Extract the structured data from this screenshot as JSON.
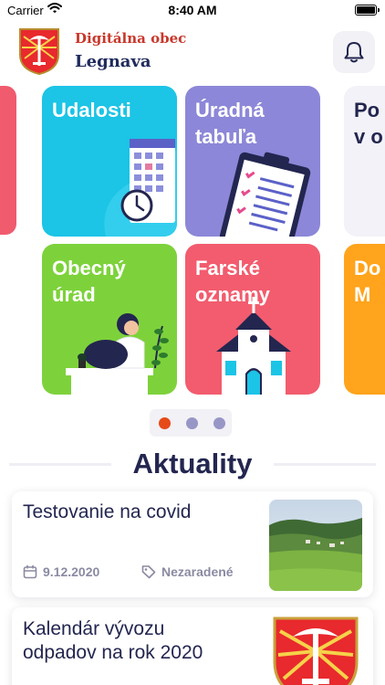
{
  "status_bar": {
    "carrier": "Carrier",
    "time": "8:40 AM",
    "icons": [
      "wifi-icon",
      "battery-icon"
    ]
  },
  "header": {
    "title_line1": "Digitálna obec",
    "title_line2": "Legnava",
    "logo": "coat-of-arms",
    "notification_icon": "bell-icon"
  },
  "tiles": [
    {
      "title": "Udalosti",
      "color": "#1cc4e6",
      "icon": "calendar-clock-illustration"
    },
    {
      "title": "Úradná\ntabuľa",
      "color": "#8c87d8",
      "icon": "clipboard-document-illustration"
    },
    {
      "title": "Po\nv o",
      "color": "#f2f2f8",
      "icon": ""
    },
    {
      "title": "Obecný\núrad",
      "color": "#7dd23b",
      "icon": "person-at-laptop-illustration"
    },
    {
      "title": "Farské\noznamy",
      "color": "#f25c6e",
      "icon": "church-illustration"
    },
    {
      "title": "Do\nM",
      "color": "#ffa41c",
      "icon": ""
    }
  ],
  "pager": {
    "active_color": "#e64a19",
    "inactive_color": "#9896c6",
    "count": 3,
    "active_index": 0
  },
  "news": {
    "section_title": "Aktuality",
    "items": [
      {
        "title": "Testovanie na covid",
        "date": "9.12.2020",
        "category": "Nezaradené",
        "thumbnail": "landscape-photo"
      },
      {
        "title": "Kalendár vývozu\nodpadov na rok 2020",
        "thumbnail": "coat-of-arms"
      }
    ]
  }
}
